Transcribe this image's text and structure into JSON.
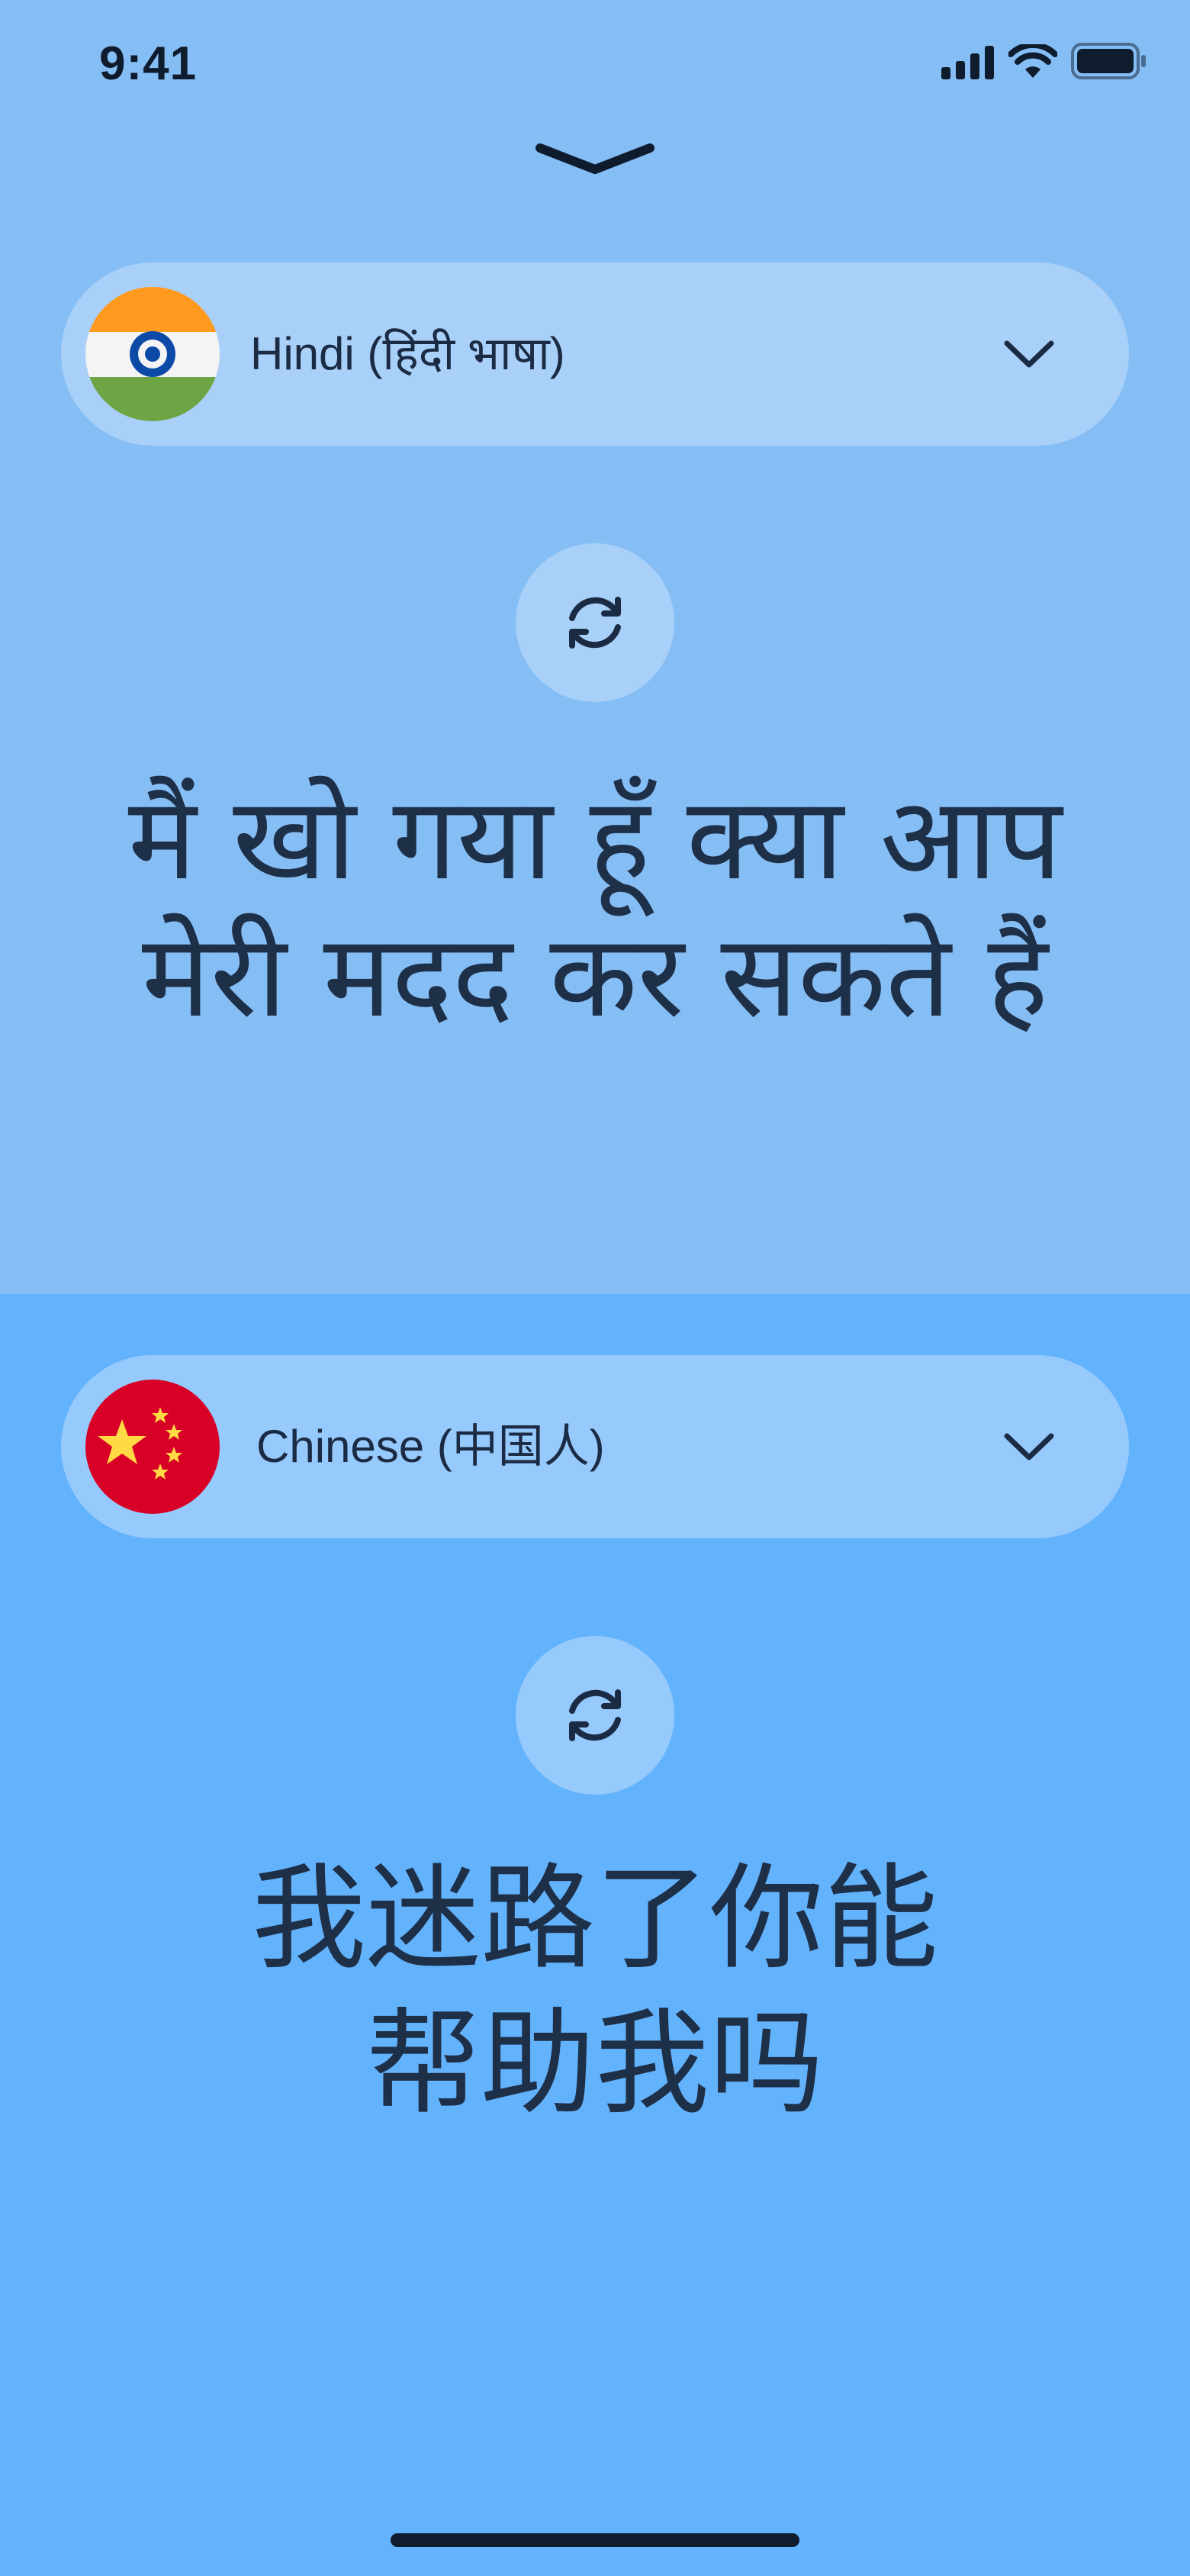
{
  "status_bar": {
    "time": "9:41",
    "icons": [
      "cellular-signal-icon",
      "wifi-icon",
      "battery-icon"
    ]
  },
  "collapse_handle": {
    "icon": "chevron-down-icon"
  },
  "source": {
    "language_label": "Hindi (हिंदी भाषा)",
    "flag": "india-flag-icon",
    "dropdown_icon": "chevron-down-icon",
    "swap_icon": "refresh-icon",
    "phrase_lines": [
      "मैं खो गया हूँ क्या आप",
      "मेरी मदद कर सकते हैं"
    ]
  },
  "target": {
    "language_label": "Chinese (中国人)",
    "flag": "china-flag-icon",
    "dropdown_icon": "chevron-down-icon",
    "swap_icon": "refresh-icon",
    "phrase_lines": [
      "我迷路了你能",
      "帮助我吗"
    ]
  },
  "colors": {
    "top_pane": "#85bdf5",
    "bottom_pane": "#63b2fc",
    "text": "#1c2b44"
  }
}
